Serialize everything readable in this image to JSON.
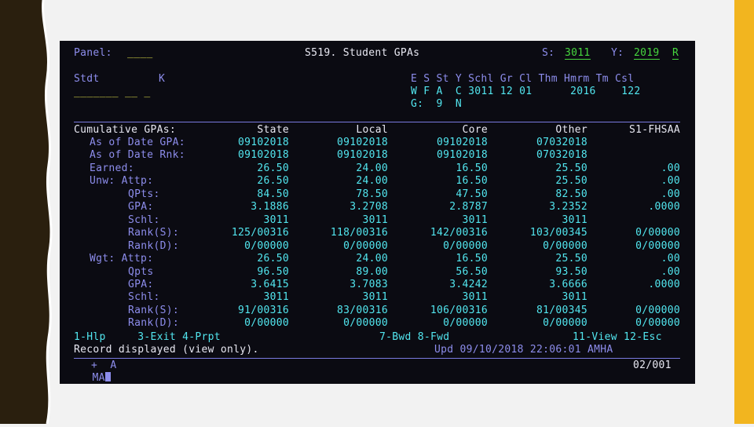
{
  "colors": {
    "blue": "#8d8dec",
    "turquoise": "#52e6ef",
    "white": "#e8e8f2",
    "green": "#46d63e",
    "yellow": "#e2e24a",
    "slide_accent": "#f2b51f",
    "left_band": "#2a1f0e"
  },
  "header": {
    "panel_label": "Panel:",
    "panel_value": "____",
    "screen_title": "S519. Student GPAs",
    "school_label": "S:",
    "school_value": "3011",
    "year_label": "Y:",
    "year_value": "2019",
    "term_value": "R"
  },
  "student": {
    "stdt_label": "Stdt",
    "k_label": "K",
    "input_underline": "_______ __ _",
    "line1": "E S St Y Schl Gr Cl Thm Hmrm Tm Csl",
    "line2": "W F A  C 3011 12 01      2016    122",
    "line3": "G:  9  N"
  },
  "table": {
    "headers": [
      "Cumulative GPAs:",
      "State",
      "Local",
      "Core",
      "Other",
      "S1-FHSAA"
    ],
    "rows": [
      {
        "label": "As of Date GPA:",
        "values": [
          "09102018",
          "09102018",
          "09102018",
          "07032018",
          ""
        ]
      },
      {
        "label": "As of Date Rnk:",
        "values": [
          "09102018",
          "09102018",
          "09102018",
          "07032018",
          ""
        ]
      },
      {
        "label": "Earned:",
        "values": [
          "26.50",
          "24.00",
          "16.50",
          "25.50",
          ".00"
        ]
      },
      {
        "label": "Unw: Attp:",
        "values": [
          "26.50",
          "24.00",
          "16.50",
          "25.50",
          ".00"
        ]
      },
      {
        "label": "QPts:",
        "values": [
          "84.50",
          "78.50",
          "47.50",
          "82.50",
          ".00"
        ]
      },
      {
        "label": "GPA:",
        "values": [
          "3.1886",
          "3.2708",
          "2.8787",
          "3.2352",
          ".0000"
        ]
      },
      {
        "label": "Schl:",
        "values": [
          "3011",
          "3011",
          "3011",
          "3011",
          ""
        ]
      },
      {
        "label": "Rank(S):",
        "values": [
          "125/00316",
          "118/00316",
          "142/00316",
          "103/00345",
          "0/00000"
        ]
      },
      {
        "label": "Rank(D):",
        "values": [
          "0/00000",
          "0/00000",
          "0/00000",
          "0/00000",
          "0/00000"
        ]
      },
      {
        "label": "Wgt: Attp:",
        "values": [
          "26.50",
          "24.00",
          "16.50",
          "25.50",
          ".00"
        ]
      },
      {
        "label": "Qpts",
        "values": [
          "96.50",
          "89.00",
          "56.50",
          "93.50",
          ".00"
        ]
      },
      {
        "label": "GPA:",
        "values": [
          "3.6415",
          "3.7083",
          "3.4242",
          "3.6666",
          ".0000"
        ]
      },
      {
        "label": "Schl:",
        "values": [
          "3011",
          "3011",
          "3011",
          "3011",
          ""
        ]
      },
      {
        "label": "Rank(S):",
        "values": [
          "91/00316",
          "83/00316",
          "106/00316",
          "81/00345",
          "0/00000"
        ]
      },
      {
        "label": "Rank(D):",
        "values": [
          "0/00000",
          "0/00000",
          "0/00000",
          "0/00000",
          "0/00000"
        ]
      }
    ]
  },
  "footer": {
    "keys_left": "1-Hlp     3-Exit 4-Prpt",
    "keys_mid": "7-Bwd 8-Fwd",
    "keys_right": "11-View 12-Esc",
    "status": "Record displayed (view only).",
    "updated": "Upd 09/10/2018 22:06:01 AMHA",
    "mode": "MA",
    "mode_flags": "+  A",
    "position": "02/001"
  }
}
